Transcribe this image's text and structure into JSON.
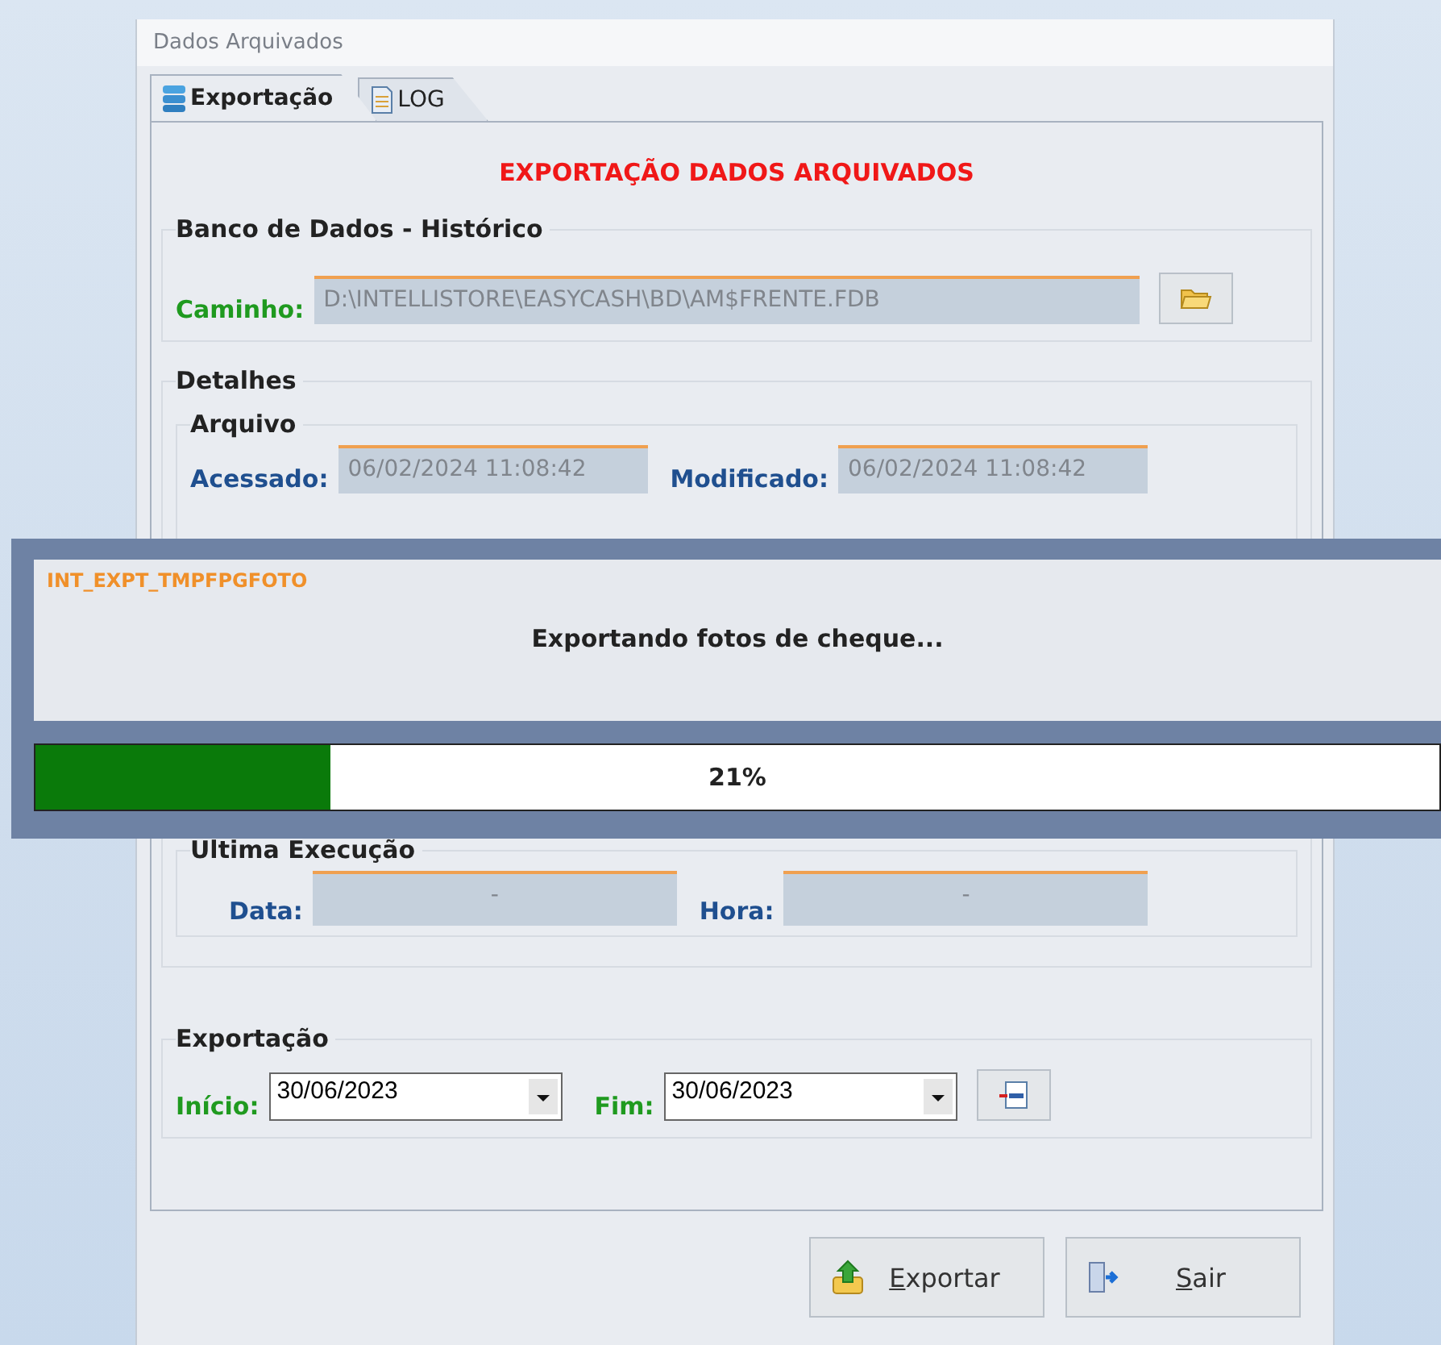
{
  "window": {
    "title": "Dados Arquivados"
  },
  "tabs": [
    {
      "label": "Exportação",
      "selected": true,
      "kind": "database"
    },
    {
      "label": "LOG",
      "selected": false,
      "kind": "document"
    }
  ],
  "heading": "EXPORTAÇÃO DADOS ARQUIVADOS",
  "database": {
    "title": "Banco de Dados - Histórico",
    "path_label": "Caminho:",
    "path": "D:\\INTELLISTORE\\EASYCASH\\BD\\AM$FRENTE.FDB"
  },
  "details": {
    "title": "Detalhes",
    "file": {
      "title": "Arquivo",
      "accessed_label": "Acessado:",
      "accessed": "06/02/2024 11:08:42",
      "modified_label": "Modificado:",
      "modified": "06/02/2024 11:08:42"
    },
    "last_run": {
      "title": "Ultima Execução",
      "date_label": "Data:",
      "date": "-",
      "time_label": "Hora:",
      "time": "-"
    }
  },
  "export": {
    "title": "Exportação",
    "start_label": "Início:",
    "start": "30/06/2023",
    "end_label": "Fim:",
    "end": "30/06/2023"
  },
  "buttons": [
    {
      "label": "Exportar",
      "kind": "export"
    },
    {
      "label": "Sair",
      "kind": "exit"
    }
  ],
  "progress": {
    "task": "INT_EXPT_TMPFPGFOTO",
    "message": "Exportando fotos de cheque...",
    "level": 0.21,
    "reading": "21%"
  }
}
